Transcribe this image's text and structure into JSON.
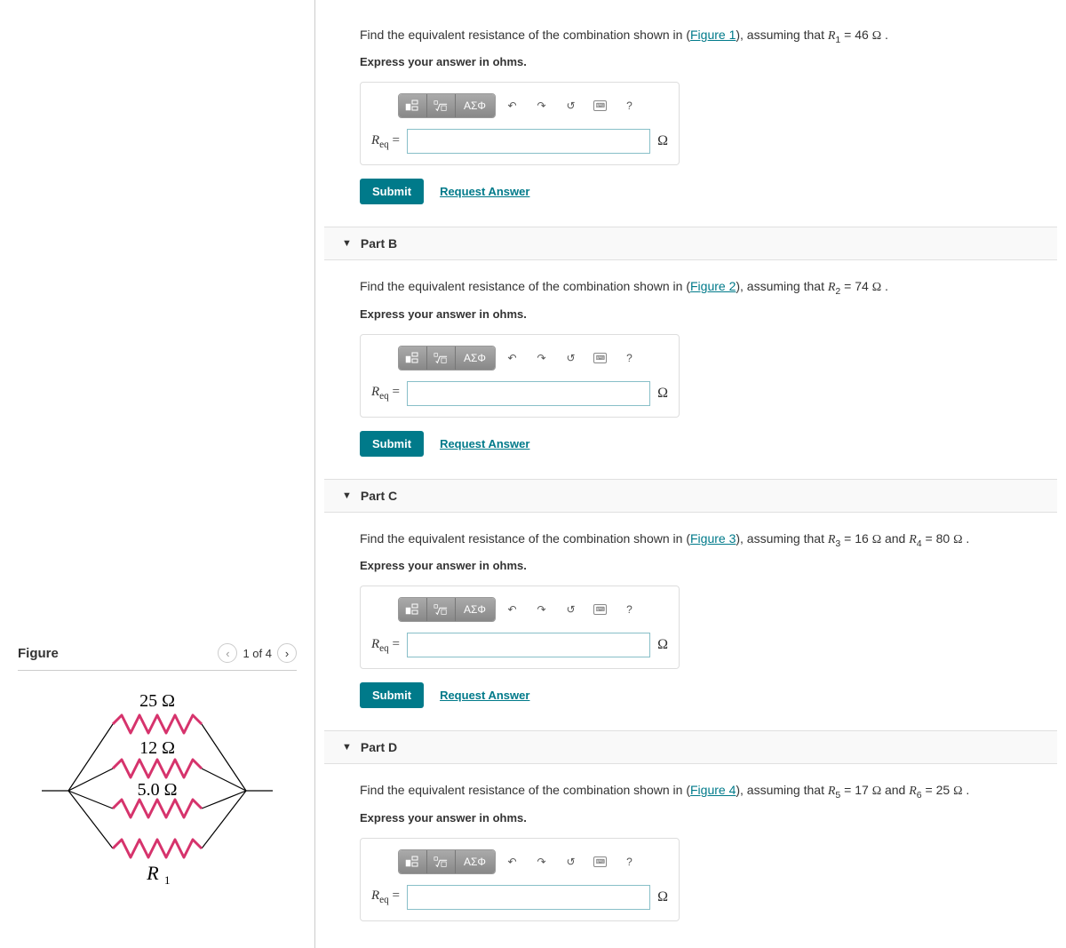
{
  "figure": {
    "title": "Figure",
    "pager": "1 of 4",
    "r_top": "25 Ω",
    "r_mid1": "12 Ω",
    "r_mid2": "5.0 Ω",
    "r_bottom": "R",
    "r_bottom_sub": "1"
  },
  "toolbar": {
    "greek": "ΑΣΦ",
    "help": "?"
  },
  "answer": {
    "label_html": "R",
    "label_sub": "eq",
    "equals": " =",
    "unit": "Ω",
    "submit": "Submit",
    "request": "Request Answer"
  },
  "partA": {
    "prefix": "Find the equivalent resistance of the combination shown in (",
    "figlink": "Figure 1",
    "mid": "), assuming that ",
    "var": "R",
    "varsub": "1",
    "val": " = 46 ",
    "unit": "Ω",
    "end": " .",
    "express": "Express your answer in ohms."
  },
  "partB": {
    "title": "Part B",
    "prefix": "Find the equivalent resistance of the combination shown in (",
    "figlink": "Figure 2",
    "mid": "), assuming that ",
    "var": "R",
    "varsub": "2",
    "val": " = 74 ",
    "unit": "Ω",
    "end": " .",
    "express": "Express your answer in ohms."
  },
  "partC": {
    "title": "Part C",
    "prefix": "Find the equivalent resistance of the combination shown in (",
    "figlink": "Figure 3",
    "mid": "), assuming that ",
    "var1": "R",
    "varsub1": "3",
    "val1": " = 16 ",
    "unit1": "Ω",
    "and": " and ",
    "var2": "R",
    "varsub2": "4",
    "val2": " = 80 ",
    "unit2": "Ω",
    "end": " .",
    "express": "Express your answer in ohms."
  },
  "partD": {
    "title": "Part D",
    "prefix": "Find the equivalent resistance of the combination shown in (",
    "figlink": "Figure 4",
    "mid": "), assuming that ",
    "var1": "R",
    "varsub1": "5",
    "val1": " = 17 ",
    "unit1": "Ω",
    "and": " and ",
    "var2": "R",
    "varsub2": "6",
    "val2": " = 25 ",
    "unit2": "Ω",
    "end": " .",
    "express": "Express your answer in ohms."
  }
}
